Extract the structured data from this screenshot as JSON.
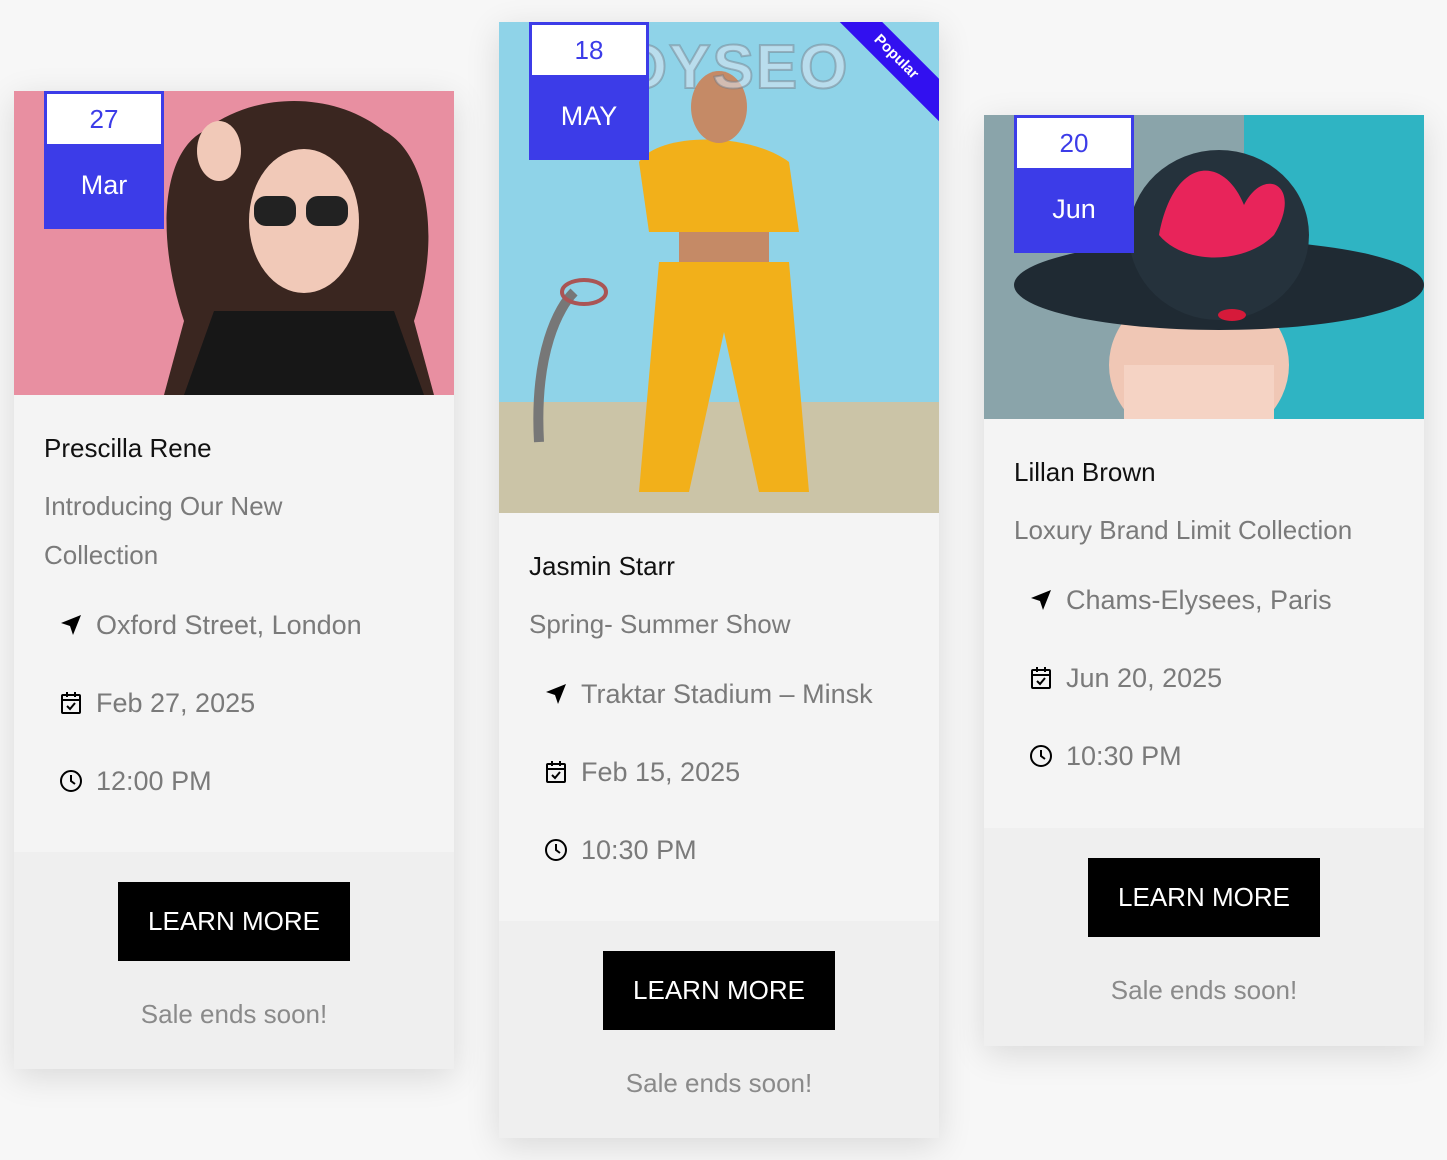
{
  "cards": [
    {
      "date": {
        "day": "27",
        "month": "Mar"
      },
      "organizer": "Prescilla Rene",
      "title": "Introducing Our New Collection",
      "location": "Oxford Street, London",
      "date_text": "Feb 27, 2025",
      "time": "12:00 PM",
      "button_label": "LEARN MORE",
      "sale_note": "Sale ends soon!"
    },
    {
      "date": {
        "day": "18",
        "month": "MAY"
      },
      "ribbon": "Popular",
      "watermark": "LOYSEO",
      "organizer": "Jasmin Starr",
      "title": "Spring- Summer Show",
      "location": "Traktar Stadium – Minsk",
      "date_text": "Feb 15, 2025",
      "time": "10:30 PM",
      "button_label": "LEARN MORE",
      "sale_note": "Sale ends soon!"
    },
    {
      "date": {
        "day": "20",
        "month": "Jun"
      },
      "organizer": "Lillan Brown",
      "title": "Loxury Brand Limit Collection",
      "location": "Chams-Elysees, Paris",
      "date_text": "Jun 20, 2025",
      "time": "10:30 PM",
      "button_label": "LEARN MORE",
      "sale_note": "Sale ends soon!"
    }
  ],
  "icons": {
    "location": "navigation-arrow-icon",
    "date": "calendar-check-icon",
    "time": "clock-icon"
  },
  "colors": {
    "accent": "#3c3ce8",
    "ribbon": "#3210f0",
    "button": "#000000"
  }
}
